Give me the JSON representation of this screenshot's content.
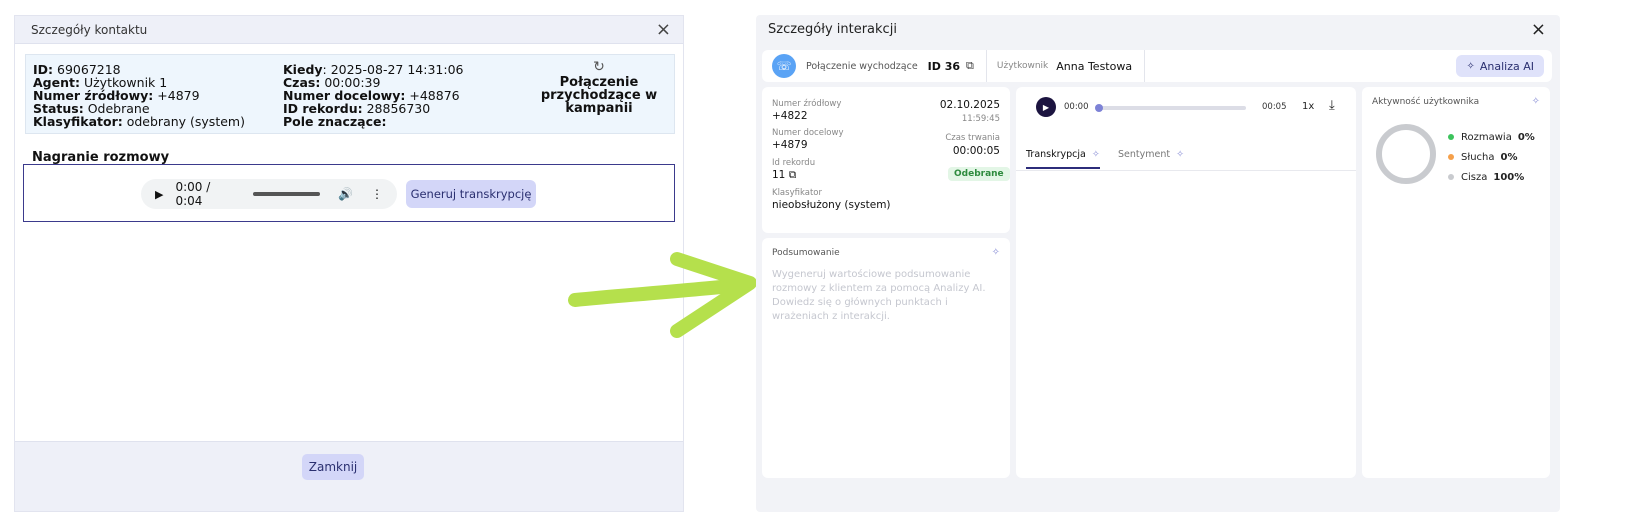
{
  "old": {
    "title": "Szczegóły kontaktu",
    "close_icon": "×",
    "info": {
      "id_label": "ID:",
      "id_value": "69067218",
      "agent_label": "Agent:",
      "agent_value": "Użytkownik 1",
      "src_label": "Numer źródłowy:",
      "src_value": "+4879",
      "status_label": "Status:",
      "status_value": "Odebrane",
      "klas_label": "Klasyfikator:",
      "klas_value": "odebrany (system)",
      "kiedy_label": "Kiedy",
      "kiedy_value": ": 2025-08-27 14:31:06",
      "czas_label": "Czas:",
      "czas_value": "00:00:39",
      "dst_label": "Numer docelowy:",
      "dst_value": "+48876",
      "rec_label": "ID rekordu:",
      "rec_value": "28856730",
      "pole_label": "Pole znaczące:",
      "campaign_icon": "↻",
      "campaign_text": "Połączenie przychodzące w kampanii"
    },
    "recording_label": "Nagranie rozmowy",
    "audio_time": "0:00 / 0:04",
    "generate_button": "Generuj transkrypcję",
    "close_button": "Zamknij"
  },
  "new": {
    "title": "Szczegóły interakcji",
    "close_icon": "×",
    "topbar": {
      "call_type": "Połączenie wychodzące",
      "id_text": "ID 36",
      "user_label": "Użytkownik",
      "user_name": "Anna Testowa",
      "ai_button": "Analiza AI"
    },
    "details": {
      "src_label": "Numer źródłowy",
      "src_value": "+4822",
      "date": "02.10.2025",
      "time": "11:59:45",
      "dst_label": "Numer docelowy",
      "dst_value": "+4879",
      "duration_label": "Czas trwania",
      "duration_value": "00:00:05",
      "rec_label": "Id rekordu",
      "rec_value": "11",
      "status_badge": "Odebrane",
      "klas_label": "Klasyfikator",
      "klas_value": "nieobsłużony (system)"
    },
    "summary": {
      "title": "Podsumowanie",
      "placeholder": "Wygeneruj wartościowe podsumowanie rozmowy z klientem za pomocą Analizy AI. Dowiedz się o głównych punktach i wrażeniach z interakcji."
    },
    "player": {
      "current_time": "00:00",
      "total_time": "00:05",
      "progress": 0,
      "speed": "1x",
      "tabs": [
        "Transkrypcja",
        "Sentyment"
      ]
    },
    "activity": {
      "title": "Aktywność użytkownika",
      "items": [
        {
          "label": "Rozmawia",
          "value": "0%",
          "color": "#3cc35c"
        },
        {
          "label": "Słucha",
          "value": "0%",
          "color": "#f5a04a"
        },
        {
          "label": "Cisza",
          "value": "100%",
          "color": "#c9cbcf"
        }
      ]
    }
  }
}
